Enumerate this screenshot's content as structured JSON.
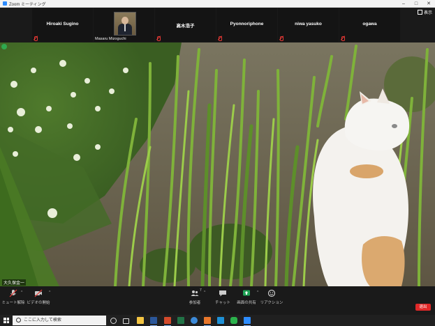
{
  "window": {
    "title": "Zoom ミーティング",
    "view_label": "表示"
  },
  "participants": [
    {
      "name": "Hiroaki Sugino",
      "muted": true
    },
    {
      "name": "Masaru Mizoguchi",
      "photo": true,
      "muted": false
    },
    {
      "name": "高木浩子",
      "muted": true
    },
    {
      "name": "Pyonnoriphone",
      "muted": true
    },
    {
      "name": "niwa yasuko",
      "muted": true
    },
    {
      "name": "ogawa",
      "muted": true
    }
  ],
  "main_video": {
    "speaker_name": "大久保金一"
  },
  "toolbar": {
    "mute_label": "ミュート解除",
    "video_label": "ビデオの開始",
    "participants_label": "参加者",
    "participants_count": "7",
    "chat_label": "チャット",
    "share_label": "画面の共有",
    "reactions_label": "リアクション",
    "leave_label": "退出",
    "share_color": "#1fa355",
    "leave_color": "#e02828"
  },
  "taskbar": {
    "search_placeholder": "ここに入力して検索"
  }
}
